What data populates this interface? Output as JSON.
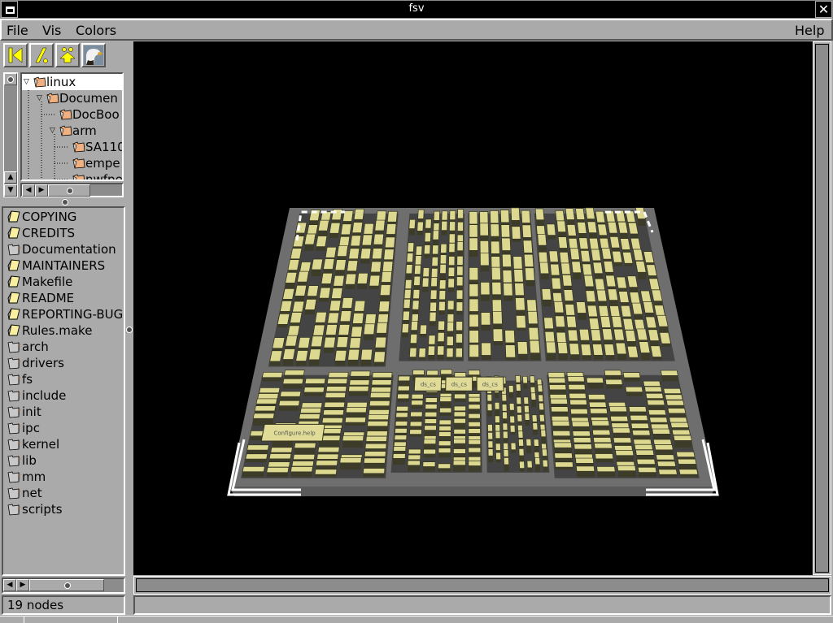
{
  "window": {
    "title": "fsv",
    "close_glyph": "✕"
  },
  "menubar": {
    "file": "File",
    "vis": "Vis",
    "colors": "Colors",
    "help": "Help"
  },
  "toolbar": {
    "buttons": [
      {
        "name": "back-to-root-button",
        "icon": "skip-back-icon"
      },
      {
        "name": "cd-up-button",
        "icon": "slash-icon"
      },
      {
        "name": "birdseye-button",
        "icon": "up-arrow-people-icon"
      },
      {
        "name": "eagle-view-button",
        "icon": "eagle-icon"
      }
    ]
  },
  "tree": {
    "items": [
      {
        "label": "linux",
        "depth": 0,
        "expanded": true,
        "selected": true
      },
      {
        "label": "Documen",
        "depth": 1,
        "expanded": true
      },
      {
        "label": "DocBoo",
        "depth": 2,
        "expanded": false
      },
      {
        "label": "arm",
        "depth": 2,
        "expanded": true
      },
      {
        "label": "SA110",
        "depth": 3,
        "expanded": false
      },
      {
        "label": "empe",
        "depth": 3,
        "expanded": false
      },
      {
        "label": "nwfpe",
        "depth": 3,
        "expanded": false
      }
    ]
  },
  "file_list": {
    "items": [
      {
        "label": "COPYING",
        "type": "file"
      },
      {
        "label": "CREDITS",
        "type": "file"
      },
      {
        "label": "Documentation",
        "type": "folder"
      },
      {
        "label": "MAINTAINERS",
        "type": "file"
      },
      {
        "label": "Makefile",
        "type": "file"
      },
      {
        "label": "README",
        "type": "file"
      },
      {
        "label": "REPORTING-BUGS",
        "type": "file"
      },
      {
        "label": "Rules.make",
        "type": "file"
      },
      {
        "label": "arch",
        "type": "folder"
      },
      {
        "label": "drivers",
        "type": "folder"
      },
      {
        "label": "fs",
        "type": "folder"
      },
      {
        "label": "include",
        "type": "folder"
      },
      {
        "label": "init",
        "type": "folder"
      },
      {
        "label": "ipc",
        "type": "folder"
      },
      {
        "label": "kernel",
        "type": "folder"
      },
      {
        "label": "lib",
        "type": "folder"
      },
      {
        "label": "mm",
        "type": "folder"
      },
      {
        "label": "net",
        "type": "folder"
      },
      {
        "label": "scripts",
        "type": "folder"
      }
    ]
  },
  "status": {
    "left": "19 nodes",
    "right": ""
  },
  "viewport": {
    "description": "3D MapV filesystem visualization",
    "colors": {
      "block_top": "#dcd890",
      "block_dark": "#3c3c28",
      "floor": "#5a5a5a",
      "platform": "#6e6e6e",
      "cursor": "#ffffff"
    },
    "labels": [
      "Configure.help",
      "ds_cs",
      "ds_cs",
      "ds_cs"
    ]
  }
}
